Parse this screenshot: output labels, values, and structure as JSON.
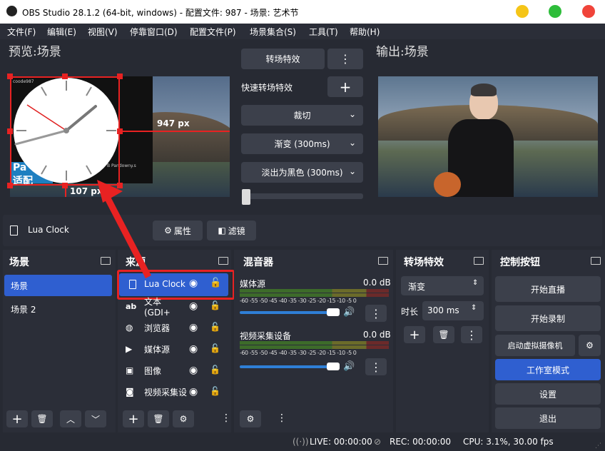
{
  "window": {
    "title": "OBS Studio 28.1.2 (64-bit, windows) - 配置文件: 987 - 场景: 艺术节"
  },
  "menu": [
    "文件(F)",
    "编辑(E)",
    "视图(V)",
    "停靠窗口(D)",
    "配置文件(P)",
    "场景集合(S)",
    "工具(T)",
    "帮助(H)"
  ],
  "preview": {
    "label": "预览:场景",
    "clock_caption": "coode987",
    "dim_w": "947 px",
    "dim_h": "107 px",
    "overlay_text_1": "Pa",
    "overlay_text_2": "适配",
    "overlay_small": "B Pandowny.s"
  },
  "output": {
    "label": "输出:场景"
  },
  "transition_panel": {
    "transition_btn": "转场特效",
    "quick_label": "快速转场特效",
    "opt1": "裁切",
    "opt2": "渐变 (300ms)",
    "opt3": "淡出为黑色 (300ms)"
  },
  "source_bar": {
    "name": "Lua Clock",
    "properties": "属性",
    "filters": "滤镜"
  },
  "scenes": {
    "title": "场景",
    "items": [
      "场景",
      "场景 2"
    ]
  },
  "sources": {
    "title": "来源",
    "items": [
      "Lua Clock",
      "文本 (GDI+",
      "浏览器",
      "媒体源",
      "图像",
      "视频采集设"
    ]
  },
  "mixer": {
    "title": "混音器",
    "channels": [
      {
        "name": "媒体源",
        "db": "0.0 dB"
      },
      {
        "name": "视频采集设备",
        "db": "0.0 dB"
      }
    ],
    "scale": "-60 -55 -50 -45 -40 -35 -30 -25 -20 -15 -10 -5 0"
  },
  "transitions": {
    "title": "转场特效",
    "selected": "渐变",
    "duration_label": "时长",
    "duration": "300 ms"
  },
  "controls": {
    "title": "控制按钮",
    "start_stream": "开始直播",
    "start_record": "开始录制",
    "virtual_cam": "启动虚拟摄像机",
    "studio_mode": "工作室模式",
    "settings": "设置",
    "exit": "退出"
  },
  "status": {
    "live": "LIVE: 00:00:00",
    "rec": "REC: 00:00:00",
    "cpu": "CPU: 3.1%, 30.00 fps"
  },
  "colors": {
    "accent": "#2f5fd0",
    "selection": "#e82222",
    "panel": "#2b2e38",
    "bg": "#272a33"
  }
}
